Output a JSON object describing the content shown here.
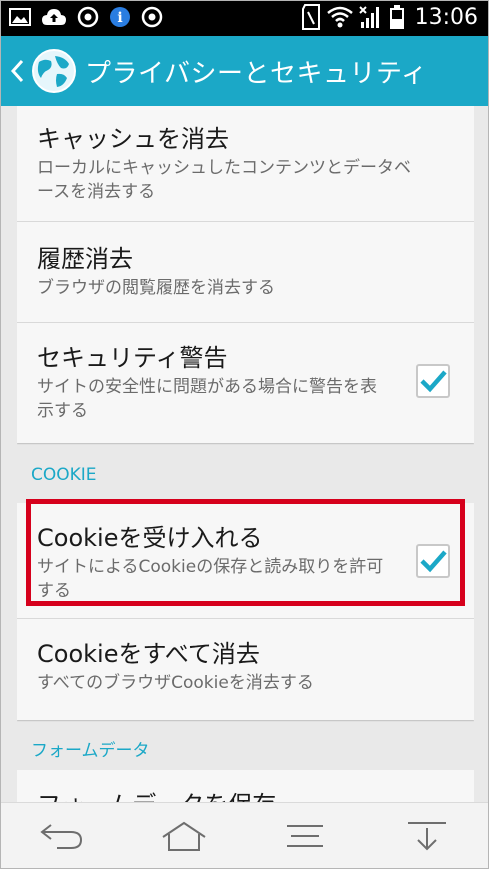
{
  "status_bar": {
    "time": "13:06",
    "icons": [
      "image-icon",
      "cloud-upload-icon",
      "record-icon",
      "info-icon",
      "record-icon",
      "sd-card-icon",
      "wifi-icon",
      "signal-icon",
      "battery-icon"
    ]
  },
  "action_bar": {
    "title": "プライバシーとセキュリティ"
  },
  "settings": {
    "group1": [
      {
        "title": "キャッシュを消去",
        "subtitle": "ローカルにキャッシュしたコンテンツとデータベースを消去する"
      },
      {
        "title": "履歴消去",
        "subtitle": "ブラウザの閲覧履歴を消去する"
      },
      {
        "title": "セキュリティ警告",
        "subtitle": "サイトの安全性に問題がある場合に警告を表示する",
        "checked": true
      }
    ],
    "cookie_header": "COOKIE",
    "cookie_group": [
      {
        "title": "Cookieを受け入れる",
        "subtitle": "サイトによるCookieの保存と読み取りを許可する",
        "checked": true
      },
      {
        "title": "Cookieをすべて消去",
        "subtitle": "すべてのブラウザCookieを消去する"
      }
    ],
    "form_header": "フォームデータ",
    "form_group": [
      {
        "title": "フォームデータを保存",
        "checked": false
      }
    ]
  },
  "colors": {
    "accent": "#1ba8c7",
    "highlight": "#d6001c"
  },
  "nav_bar": {
    "icons": [
      "back-icon",
      "home-icon",
      "menu-icon",
      "minimize-icon"
    ]
  }
}
